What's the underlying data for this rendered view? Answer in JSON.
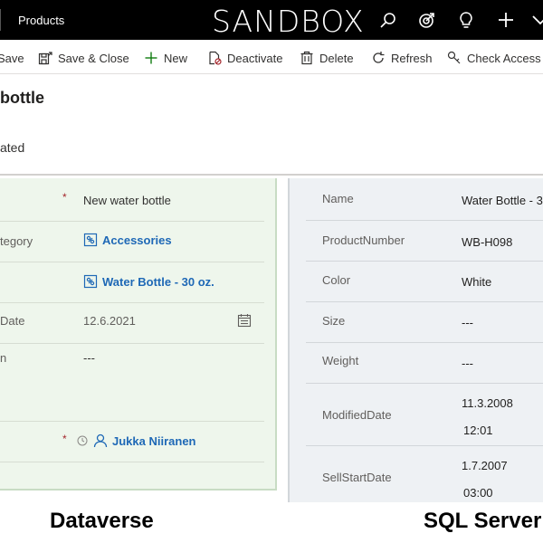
{
  "topbar": {
    "app_title": "Products",
    "brand": "SANDBOX",
    "icons": [
      "search-icon",
      "target-icon",
      "lightbulb-icon",
      "plus-icon",
      "chevron-down-icon"
    ]
  },
  "commands": [
    {
      "label": "Save",
      "icon": "save-icon"
    },
    {
      "label": "Save & Close",
      "icon": "save-close-icon"
    },
    {
      "label": "New",
      "icon": "plus-icon"
    },
    {
      "label": "Deactivate",
      "icon": "deactivate-icon"
    },
    {
      "label": "Delete",
      "icon": "trash-icon"
    },
    {
      "label": "Refresh",
      "icon": "refresh-icon"
    },
    {
      "label": "Check Access",
      "icon": "key-icon"
    }
  ],
  "header": {
    "title": "bottle",
    "subtitle": "ated"
  },
  "dataverse": {
    "caption": "Dataverse",
    "rows": [
      {
        "label": "",
        "required": "*",
        "value": "New water bottle"
      },
      {
        "label": "tegory",
        "value": "Accessories",
        "link": true
      },
      {
        "label": "",
        "value": "Water Bottle - 30 oz.",
        "link": true
      },
      {
        "label": "Date",
        "value": "12.6.2021"
      },
      {
        "label": "n",
        "value": "---"
      },
      {
        "label": "",
        "required": "*",
        "value": "Jukka Niiranen"
      }
    ]
  },
  "sqlserver": {
    "caption": "SQL Server",
    "rows": [
      {
        "label": "Name",
        "value": "Water Bottle - 3"
      },
      {
        "label": "ProductNumber",
        "value": "WB-H098"
      },
      {
        "label": "Color",
        "value": "White"
      },
      {
        "label": "Size",
        "value": "---"
      },
      {
        "label": "Weight",
        "value": "---"
      },
      {
        "label": "ModifiedDate",
        "value": "11.3.2008",
        "value2": "12:01"
      },
      {
        "label": "SellStartDate",
        "value": "1.7.2007",
        "value2": "03:00"
      }
    ]
  }
}
